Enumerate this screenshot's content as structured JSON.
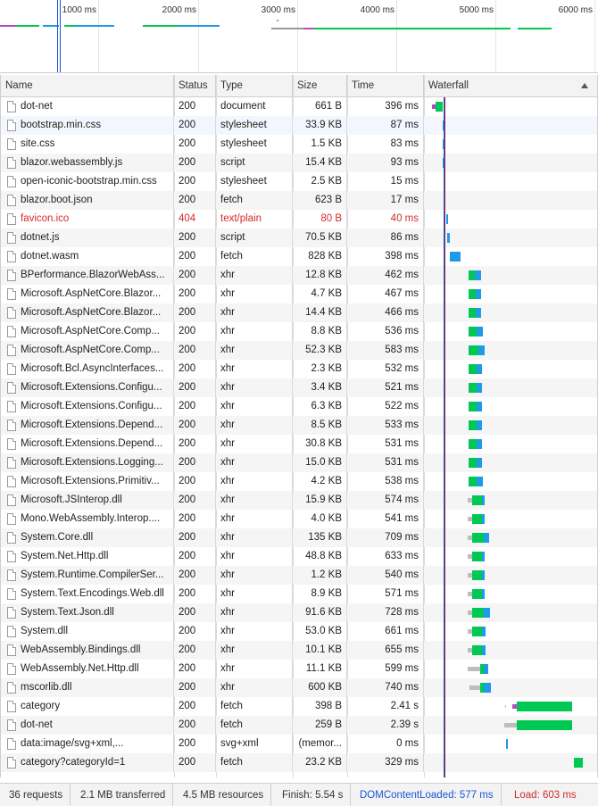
{
  "overview": {
    "ticks": [
      "1000 ms",
      "2000 ms",
      "3000 ms",
      "4000 ms",
      "5000 ms",
      "6000 ms"
    ]
  },
  "columns": {
    "name": "Name",
    "status": "Status",
    "type": "Type",
    "size": "Size",
    "time": "Time",
    "waterfall": "Waterfall"
  },
  "rows": [
    {
      "name": "dot-net",
      "status": "200",
      "type": "document",
      "size": "661 B",
      "time": "396 ms"
    },
    {
      "name": "bootstrap.min.css",
      "status": "200",
      "type": "stylesheet",
      "size": "33.9 KB",
      "time": "87 ms"
    },
    {
      "name": "site.css",
      "status": "200",
      "type": "stylesheet",
      "size": "1.5 KB",
      "time": "83 ms"
    },
    {
      "name": "blazor.webassembly.js",
      "status": "200",
      "type": "script",
      "size": "15.4 KB",
      "time": "93 ms"
    },
    {
      "name": "open-iconic-bootstrap.min.css",
      "status": "200",
      "type": "stylesheet",
      "size": "2.5 KB",
      "time": "15 ms"
    },
    {
      "name": "blazor.boot.json",
      "status": "200",
      "type": "fetch",
      "size": "623 B",
      "time": "17 ms"
    },
    {
      "name": "favicon.ico",
      "status": "404",
      "type": "text/plain",
      "size": "80 B",
      "time": "40 ms"
    },
    {
      "name": "dotnet.js",
      "status": "200",
      "type": "script",
      "size": "70.5 KB",
      "time": "86 ms"
    },
    {
      "name": "dotnet.wasm",
      "status": "200",
      "type": "fetch",
      "size": "828 KB",
      "time": "398 ms"
    },
    {
      "name": "BPerformance.BlazorWebAss...",
      "status": "200",
      "type": "xhr",
      "size": "12.8 KB",
      "time": "462 ms"
    },
    {
      "name": "Microsoft.AspNetCore.Blazor...",
      "status": "200",
      "type": "xhr",
      "size": "4.7 KB",
      "time": "467 ms"
    },
    {
      "name": "Microsoft.AspNetCore.Blazor...",
      "status": "200",
      "type": "xhr",
      "size": "14.4 KB",
      "time": "466 ms"
    },
    {
      "name": "Microsoft.AspNetCore.Comp...",
      "status": "200",
      "type": "xhr",
      "size": "8.8 KB",
      "time": "536 ms"
    },
    {
      "name": "Microsoft.AspNetCore.Comp...",
      "status": "200",
      "type": "xhr",
      "size": "52.3 KB",
      "time": "583 ms"
    },
    {
      "name": "Microsoft.Bcl.AsyncInterfaces...",
      "status": "200",
      "type": "xhr",
      "size": "2.3 KB",
      "time": "532 ms"
    },
    {
      "name": "Microsoft.Extensions.Configu...",
      "status": "200",
      "type": "xhr",
      "size": "3.4 KB",
      "time": "521 ms"
    },
    {
      "name": "Microsoft.Extensions.Configu...",
      "status": "200",
      "type": "xhr",
      "size": "6.3 KB",
      "time": "522 ms"
    },
    {
      "name": "Microsoft.Extensions.Depend...",
      "status": "200",
      "type": "xhr",
      "size": "8.5 KB",
      "time": "533 ms"
    },
    {
      "name": "Microsoft.Extensions.Depend...",
      "status": "200",
      "type": "xhr",
      "size": "30.8 KB",
      "time": "531 ms"
    },
    {
      "name": "Microsoft.Extensions.Logging...",
      "status": "200",
      "type": "xhr",
      "size": "15.0 KB",
      "time": "531 ms"
    },
    {
      "name": "Microsoft.Extensions.Primitiv...",
      "status": "200",
      "type": "xhr",
      "size": "4.2 KB",
      "time": "538 ms"
    },
    {
      "name": "Microsoft.JSInterop.dll",
      "status": "200",
      "type": "xhr",
      "size": "15.9 KB",
      "time": "574 ms"
    },
    {
      "name": "Mono.WebAssembly.Interop....",
      "status": "200",
      "type": "xhr",
      "size": "4.0 KB",
      "time": "541 ms"
    },
    {
      "name": "System.Core.dll",
      "status": "200",
      "type": "xhr",
      "size": "135 KB",
      "time": "709 ms"
    },
    {
      "name": "System.Net.Http.dll",
      "status": "200",
      "type": "xhr",
      "size": "48.8 KB",
      "time": "633 ms"
    },
    {
      "name": "System.Runtime.CompilerSer...",
      "status": "200",
      "type": "xhr",
      "size": "1.2 KB",
      "time": "540 ms"
    },
    {
      "name": "System.Text.Encodings.Web.dll",
      "status": "200",
      "type": "xhr",
      "size": "8.9 KB",
      "time": "571 ms"
    },
    {
      "name": "System.Text.Json.dll",
      "status": "200",
      "type": "xhr",
      "size": "91.6 KB",
      "time": "728 ms"
    },
    {
      "name": "System.dll",
      "status": "200",
      "type": "xhr",
      "size": "53.0 KB",
      "time": "661 ms"
    },
    {
      "name": "WebAssembly.Bindings.dll",
      "status": "200",
      "type": "xhr",
      "size": "10.1 KB",
      "time": "655 ms"
    },
    {
      "name": "WebAssembly.Net.Http.dll",
      "status": "200",
      "type": "xhr",
      "size": "11.1 KB",
      "time": "599 ms"
    },
    {
      "name": "mscorlib.dll",
      "status": "200",
      "type": "xhr",
      "size": "600 KB",
      "time": "740 ms"
    },
    {
      "name": "category",
      "status": "200",
      "type": "fetch",
      "size": "398 B",
      "time": "2.41 s"
    },
    {
      "name": "dot-net",
      "status": "200",
      "type": "fetch",
      "size": "259 B",
      "time": "2.39 s"
    },
    {
      "name": "data:image/svg+xml,...",
      "status": "200",
      "type": "svg+xml",
      "size": "(memor...",
      "time": "0 ms"
    },
    {
      "name": "category?categoryId=1",
      "status": "200",
      "type": "fetch",
      "size": "23.2 KB",
      "time": "329 ms"
    }
  ],
  "status_bar": {
    "requests": "36 requests",
    "transferred": "2.1 MB transferred",
    "resources": "4.5 MB resources",
    "finish": "Finish: 5.54 s",
    "dom_content_loaded": "DOMContentLoaded: 577 ms",
    "load": "Load: 603 ms"
  },
  "colors": {
    "waiting": "#00c853",
    "download": "#1e9be8",
    "stalled": "#bdbdbd",
    "connect": "#b24bc4",
    "dom_content_loaded_line": "#1a56d6",
    "load_line": "#9c2a4a",
    "error_text": "#d32b2b"
  }
}
